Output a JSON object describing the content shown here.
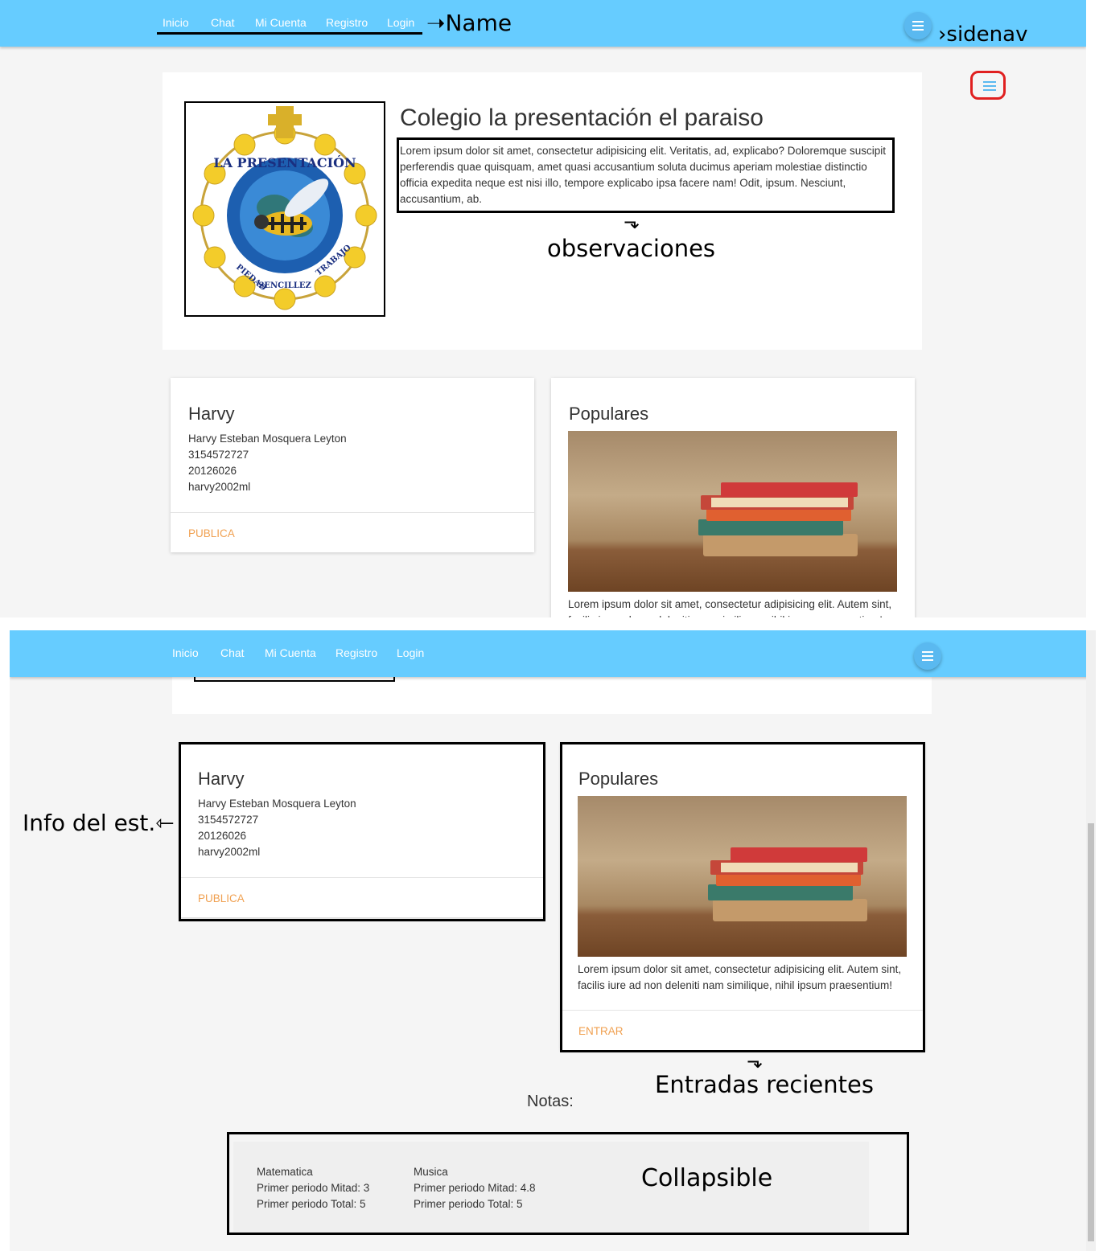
{
  "nav": {
    "links": [
      "Inicio",
      "Chat",
      "Mi Cuenta",
      "Registro",
      "Login"
    ]
  },
  "school": {
    "title": "Colegio la presentación el paraiso",
    "description": "Lorem ipsum dolor sit amet, consectetur adipisicing elit. Veritatis, ad, explicabo? Doloremque suscipit perferendis quae quisquam, amet quasi accusantium soluta ducimus aperiam molestiae distinctio officia expedita neque est nisi illo, tempore explicabo ipsa facere nam! Odit, ipsum. Nesciunt, accusantium, ab.",
    "logo_texts": [
      "LA PRESENTACIÓN",
      "PIEDAD",
      "SENCILLEZ",
      "TRABAJO"
    ]
  },
  "student_card": {
    "title": "Harvy",
    "name": "Harvy Esteban Mosquera Leyton",
    "phone": "3154572727",
    "code": "20126026",
    "user": "harvy2002ml",
    "action": "PUBLICA"
  },
  "popular_card": {
    "title": "Populares",
    "text": "Lorem ipsum dolor sit amet, consectetur adipisicing elit. Autem sint, facilis iure ad non deleniti nam similique, nihil ipsum praesentium!",
    "action": "ENTRAR"
  },
  "notes": {
    "label": "Notas:",
    "subjects": [
      {
        "name": "Matematica",
        "mid": "Primer periodo Mitad: 3",
        "total": "Primer periodo Total: 5"
      },
      {
        "name": "Musica",
        "mid": "Primer periodo Mitad: 4.8",
        "total": "Primer periodo Total: 5"
      }
    ]
  },
  "annotations": {
    "name": "Name",
    "sidenav": "sidenav",
    "observaciones": "observaciones",
    "info": "Info del est.",
    "entradas": "Entradas recientes",
    "collapsible": "Collapsible"
  },
  "colors": {
    "navbar": "#66ccff",
    "accent_action": "#f0a050",
    "page_bg": "#f5f5f5",
    "annotation_box": "#000000",
    "sidenav_icon_mark": "#e02020"
  }
}
